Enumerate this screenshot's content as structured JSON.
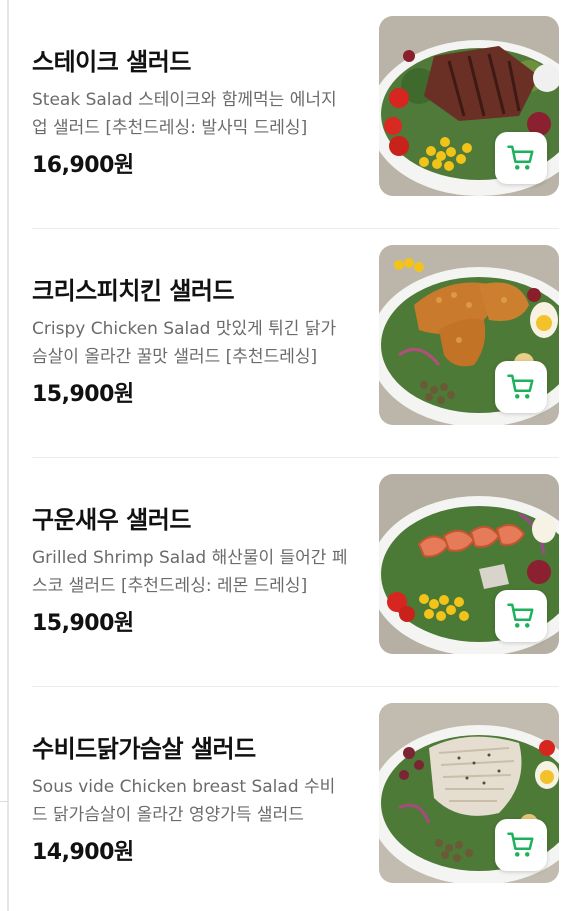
{
  "theme": {
    "accent": "#1bb25b",
    "title_color": "#111111",
    "desc_color": "#6b6b6b",
    "divider_color": "#ececec"
  },
  "menu": {
    "items": [
      {
        "title": "스테이크 샐러드",
        "description": "Steak Salad 스테이크와 함께먹는 에너지업 샐러드  [추천드레싱: 발사믹 드레싱]",
        "price": "16,900원",
        "photo": "steak-salad-photo",
        "cart_icon": "cart-icon"
      },
      {
        "title": "크리스피치킨 샐러드",
        "description": "Crispy Chicken Salad 맛있게 튀긴 닭가슴살이 올라간 꿀맛 샐러드 [추천드레싱]",
        "price": "15,900원",
        "photo": "crispy-chicken-salad-photo",
        "cart_icon": "cart-icon"
      },
      {
        "title": "구운새우 샐러드",
        "description": "Grilled Shrimp Salad 해산물이 들어간 페스코 샐러드  [추천드레싱: 레몬 드레싱]",
        "price": "15,900원",
        "photo": "grilled-shrimp-salad-photo",
        "cart_icon": "cart-icon"
      },
      {
        "title": "수비드닭가슴살 샐러드",
        "description": "Sous vide Chicken breast Salad 수비드 닭가슴살이 올라간 영양가득 샐러드",
        "price": "14,900원",
        "photo": "sous-vide-chicken-salad-photo",
        "cart_icon": "cart-icon"
      }
    ]
  }
}
